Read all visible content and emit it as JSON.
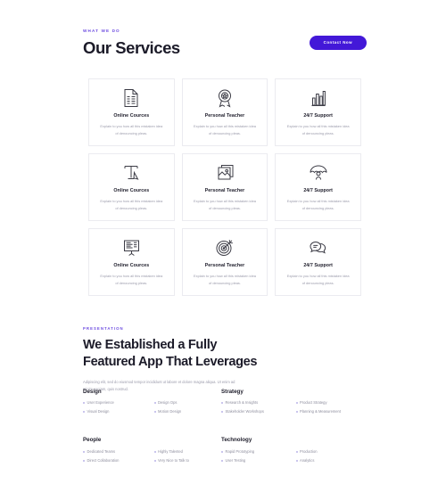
{
  "services_section": {
    "eyebrow": "WHAT WE DO",
    "title": "Our Services",
    "cta_label": "Contact Now",
    "cards": [
      {
        "icon": "document-list-icon",
        "title": "Online Cources",
        "desc": "Explain to you how all this mistaken idea of denouncing pleas."
      },
      {
        "icon": "award-badge-icon",
        "title": "Personal Teacher",
        "desc": "Explain to you how all this mistaken idea of denouncing pleas."
      },
      {
        "icon": "bar-chart-icon",
        "title": "24/7 Support",
        "desc": "Explain to you how all this mistaken idea of denouncing pleas."
      },
      {
        "icon": "typography-tool-icon",
        "title": "Online Cources",
        "desc": "Explain to you how all this mistaken idea of denouncing pleas."
      },
      {
        "icon": "image-layers-icon",
        "title": "Personal Teacher",
        "desc": "Explain to you how all this mistaken idea of denouncing pleas."
      },
      {
        "icon": "umbrella-user-icon",
        "title": "24/7 Support",
        "desc": "Explain to you how all this mistaken idea of denouncing pleas."
      },
      {
        "icon": "presentation-board-icon",
        "title": "Online Cources",
        "desc": "Explain to you how all this mistaken idea of denouncing pleas."
      },
      {
        "icon": "target-dartboard-icon",
        "title": "Personal Teacher",
        "desc": "Explain to you how all this mistaken idea of denouncing pleas."
      },
      {
        "icon": "chat-bubbles-icon",
        "title": "24/7 Support",
        "desc": "Explain to you how all this mistaken idea of denouncing pleas."
      }
    ]
  },
  "presentation_section": {
    "eyebrow": "PRESENTATION",
    "title": "We Established a Fully Featured App That Leverages",
    "paragraph": "Adipiscing elit, sed do eiusmod tempor incididunt ut labore et dolore magna aliqua. Ut enim ad minim veniam, quis nostrud.",
    "skill_groups": [
      {
        "title": "Design",
        "column_left": [
          "User Experience",
          "Visual Design"
        ],
        "column_right": [
          "Design Ops",
          "Motion Design"
        ]
      },
      {
        "title": "Strategy",
        "column_left": [
          "Research & Insights",
          "Stakeholder Workshops"
        ],
        "column_right": [
          "Product Strategy",
          "Planning & Measurement"
        ]
      },
      {
        "title": "People",
        "column_left": [
          "Dedicated Teams",
          "Direct Collaboration"
        ],
        "column_right": [
          "Highly Talented",
          "Very Nice to Talk to"
        ]
      },
      {
        "title": "Technology",
        "column_left": [
          "Rapid Prototyping",
          "User Testing"
        ],
        "column_right": [
          "Production",
          "Analytics"
        ]
      }
    ]
  },
  "colors": {
    "accent": "#4318d8",
    "eyebrow": "#6c4be0",
    "heading": "#1c1b29",
    "body_text": "#9b9bab",
    "card_border": "#ebebf0"
  }
}
